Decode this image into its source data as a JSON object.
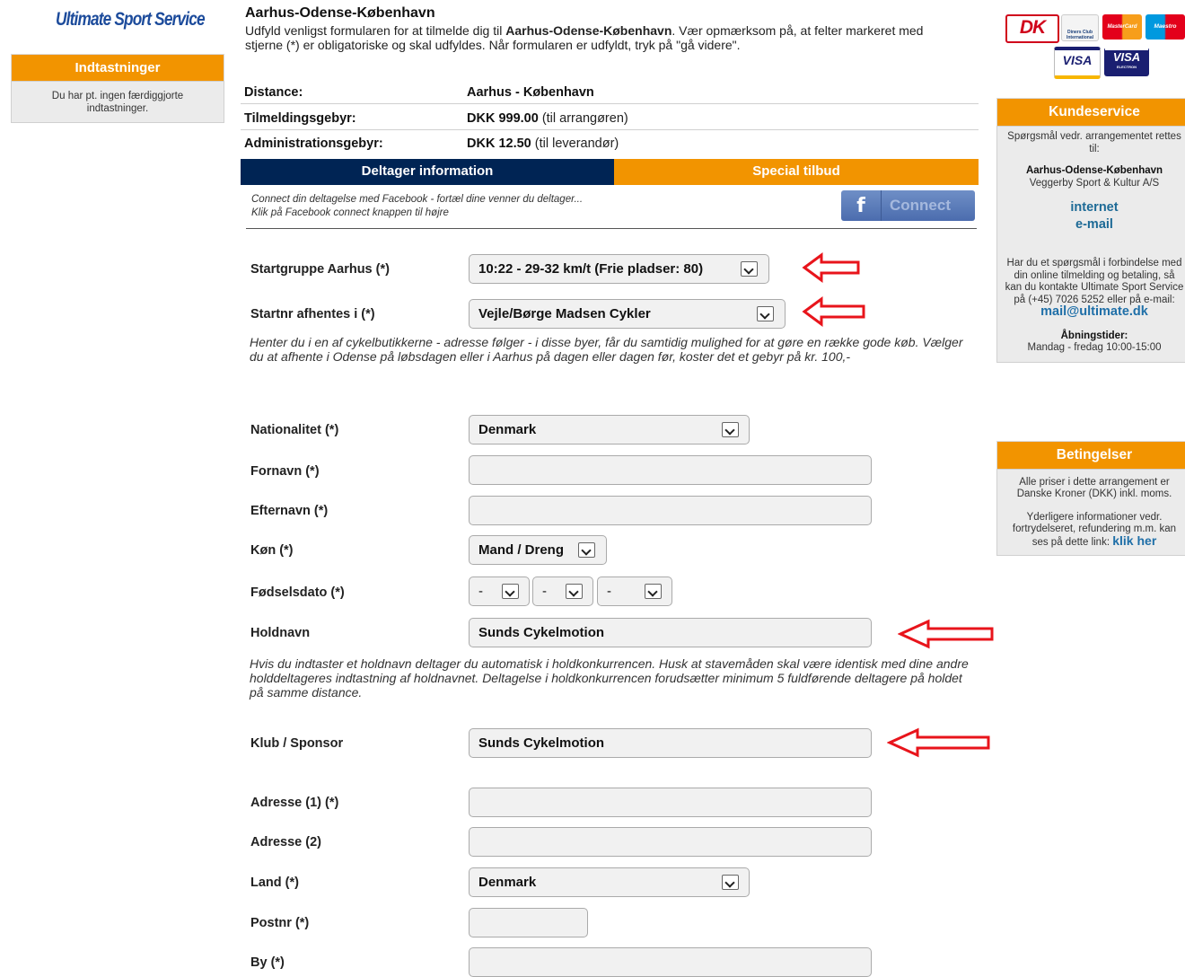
{
  "logo": "Ultimate Sport Service",
  "left_box": {
    "title": "Indtastninger",
    "text": "Du har pt. ingen færdiggjorte indtastninger."
  },
  "header": {
    "title": "Aarhus-Odense-København",
    "intro_1": "Udfyld venligst formularen for at tilmelde dig til ",
    "intro_bold": "Aarhus-Odense-København",
    "intro_2": ". Vær opmærksom på, at felter markeret med stjerne (*) er obligatoriske og skal udfyldes. Når formularen er udfyldt, tryk på \"gå videre\"."
  },
  "info": {
    "distance_label": "Distance:",
    "distance_value": "Aarhus - København",
    "fee_label": "Tilmeldingsgebyr:",
    "fee_value": "DKK 999.00",
    "fee_note": "(til arrangøren)",
    "admin_label": "Administrationsgebyr:",
    "admin_value": "DKK 12.50",
    "admin_note": "(til leverandør)"
  },
  "tabs": {
    "participant": "Deltager information",
    "special": "Special tilbud"
  },
  "facebook": {
    "line1": "Connect din deltagelse med Facebook - fortæl dine venner du deltager...",
    "line2": "Klik på Facebook connect knappen til højre",
    "button": "Connect",
    "icon_glyph": "f"
  },
  "form": {
    "startgroup_label": "Startgruppe Aarhus (*)",
    "startgroup_value": "10:22 - 29-32 km/t (Frie pladser: 80)",
    "pickup_label": "Startnr afhentes i (*)",
    "pickup_value": "Vejle/Børge Madsen Cykler",
    "pickup_note": "Henter du i en af cykelbutikkerne - adresse følger - i disse byer, får du samtidig mulighed for at gøre en række gode køb. Vælger du at afhente i Odense på løbsdagen eller i Aarhus på dagen eller dagen før, koster det et gebyr på kr. 100,-",
    "nationality_label": "Nationalitet (*)",
    "nationality_value": "Denmark",
    "firstname_label": "Fornavn (*)",
    "firstname_value": "",
    "lastname_label": "Efternavn (*)",
    "lastname_value": "",
    "gender_label": "Køn (*)",
    "gender_value": "Mand / Dreng",
    "birthdate_label": "Fødselsdato (*)",
    "birth_day": "-",
    "birth_month": "-",
    "birth_year": "-",
    "team_label": "Holdnavn",
    "team_value": "Sunds Cykelmotion",
    "team_note": "Hvis du indtaster et holdnavn deltager du automatisk i holdkonkurrencen. Husk at stavemåden skal være identisk med dine andre holddeltageres indtastning af holdnavnet. Deltagelse i holdkonkurrencen forudsætter minimum 5 fuldførende deltagere på holdet på samme distance.",
    "club_label": "Klub / Sponsor",
    "club_value": "Sunds Cykelmotion",
    "address1_label": "Adresse (1) (*)",
    "address1_value": "",
    "address2_label": "Adresse (2)",
    "address2_value": "",
    "country_label": "Land (*)",
    "country_value": "Denmark",
    "zip_label": "Postnr (*)",
    "zip_value": "",
    "city_label": "By (*)",
    "city_value": ""
  },
  "cards": {
    "dk": "DK",
    "diners": "Diners Club International",
    "mastercard": "MasterCard",
    "maestro": "Maestro",
    "visa": "VISA",
    "visa_electron": "VISA",
    "electron": "ELECTRON"
  },
  "customer_service": {
    "title": "Kundeservice",
    "text1": "Spørgsmål vedr. arrangementet rettes til:",
    "org1": "Aarhus-Odense-København",
    "org2": "Veggerby Sport & Kultur A/S",
    "link_internet": "internet",
    "link_email": "e-mail",
    "text2": "Har du et spørgsmål i forbindelse med din online tilmelding og betaling, så kan du kontakte Ultimate Sport Service på (+45) 7026 5252 eller på e-mail:",
    "mail": "mail@ultimate.dk",
    "hours_title": "Åbningstider:",
    "hours": "Mandag - fredag 10:00-15:00"
  },
  "conditions": {
    "title": "Betingelser",
    "text1": "Alle priser i dette arrangement er Danske Kroner (DKK) inkl. moms.",
    "text2": "Yderligere informationer vedr. fortrydelseret, refundering m.m. kan ses på dette link:",
    "link": "klik her"
  },
  "colors": {
    "orange": "#f29400",
    "navy": "#002454",
    "arrow_red": "#e8141b",
    "link_blue": "#1f6fa8"
  }
}
